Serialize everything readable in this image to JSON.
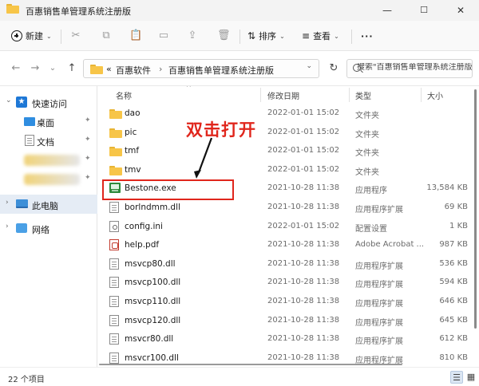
{
  "window": {
    "title": "百惠销售单管理系统注册版",
    "minimize_glyph": "—",
    "maximize_glyph": "☐",
    "close_glyph": "✕"
  },
  "toolbar": {
    "new_label": "新建",
    "sort_label": "排序",
    "view_label": "查看",
    "more_glyph": "···",
    "caret": "⌄",
    "icons": [
      "cut-icon",
      "copy-icon",
      "paste-icon",
      "rename-icon",
      "share-icon",
      "delete-icon"
    ]
  },
  "nav": {
    "back_glyph": "←",
    "forward_glyph": "→",
    "recent_glyph": "⌄",
    "up_glyph": "↑",
    "breadcrumb_overflow": "«",
    "breadcrumb": [
      "百惠软件",
      "百惠销售单管理系统注册版"
    ],
    "breadcrumb_sep": "›",
    "dropdown_glyph": "⌄",
    "refresh_glyph": "↻",
    "search_placeholder": "搜索\"百惠销售单管理系统注册版\""
  },
  "sidebar": {
    "quick_access": "快速访问",
    "desktop": "桌面",
    "documents": "文档",
    "this_pc": "此电脑",
    "network": "网络",
    "expand_glyph": "⌄",
    "collapsed_glyph": "›",
    "pin_glyph": "📌"
  },
  "columns": {
    "name": "名称",
    "date": "修改日期",
    "type": "类型",
    "size": "大小",
    "sort_glyph": "^"
  },
  "files": [
    {
      "name": "dao",
      "date": "2022-01-01 15:02",
      "type": "文件夹",
      "size": "",
      "icon": "folder"
    },
    {
      "name": "pic",
      "date": "2022-01-01 15:02",
      "type": "文件夹",
      "size": "",
      "icon": "folder"
    },
    {
      "name": "tmf",
      "date": "2022-01-01 15:02",
      "type": "文件夹",
      "size": "",
      "icon": "folder"
    },
    {
      "name": "tmv",
      "date": "2022-01-01 15:02",
      "type": "文件夹",
      "size": "",
      "icon": "folder"
    },
    {
      "name": "Bestone.exe",
      "date": "2021-10-28 11:38",
      "type": "应用程序",
      "size": "13,584 KB",
      "icon": "exe"
    },
    {
      "name": "borlndmm.dll",
      "date": "2021-10-28 11:38",
      "type": "应用程序扩展",
      "size": "69 KB",
      "icon": "doc"
    },
    {
      "name": "config.ini",
      "date": "2022-01-01 15:02",
      "type": "配置设置",
      "size": "1 KB",
      "icon": "gear"
    },
    {
      "name": "help.pdf",
      "date": "2021-10-28 11:38",
      "type": "Adobe Acrobat ...",
      "size": "987 KB",
      "icon": "pdf"
    },
    {
      "name": "msvcp80.dll",
      "date": "2021-10-28 11:38",
      "type": "应用程序扩展",
      "size": "536 KB",
      "icon": "doc"
    },
    {
      "name": "msvcp100.dll",
      "date": "2021-10-28 11:38",
      "type": "应用程序扩展",
      "size": "594 KB",
      "icon": "doc"
    },
    {
      "name": "msvcp110.dll",
      "date": "2021-10-28 11:38",
      "type": "应用程序扩展",
      "size": "646 KB",
      "icon": "doc"
    },
    {
      "name": "msvcp120.dll",
      "date": "2021-10-28 11:38",
      "type": "应用程序扩展",
      "size": "645 KB",
      "icon": "doc"
    },
    {
      "name": "msvcr80.dll",
      "date": "2021-10-28 11:38",
      "type": "应用程序扩展",
      "size": "612 KB",
      "icon": "doc"
    },
    {
      "name": "msvcr100.dll",
      "date": "2021-10-28 11:38",
      "type": "应用程序扩展",
      "size": "810 KB",
      "icon": "doc"
    }
  ],
  "annotation": {
    "text": "双击打开",
    "color": "#e0261c"
  },
  "status": {
    "item_count": "22 个项目",
    "details_view_glyph": "☰",
    "tiles_view_glyph": "▦"
  },
  "colors": {
    "selected_bg": "#e5ecf5",
    "folder": "#f7c548"
  }
}
